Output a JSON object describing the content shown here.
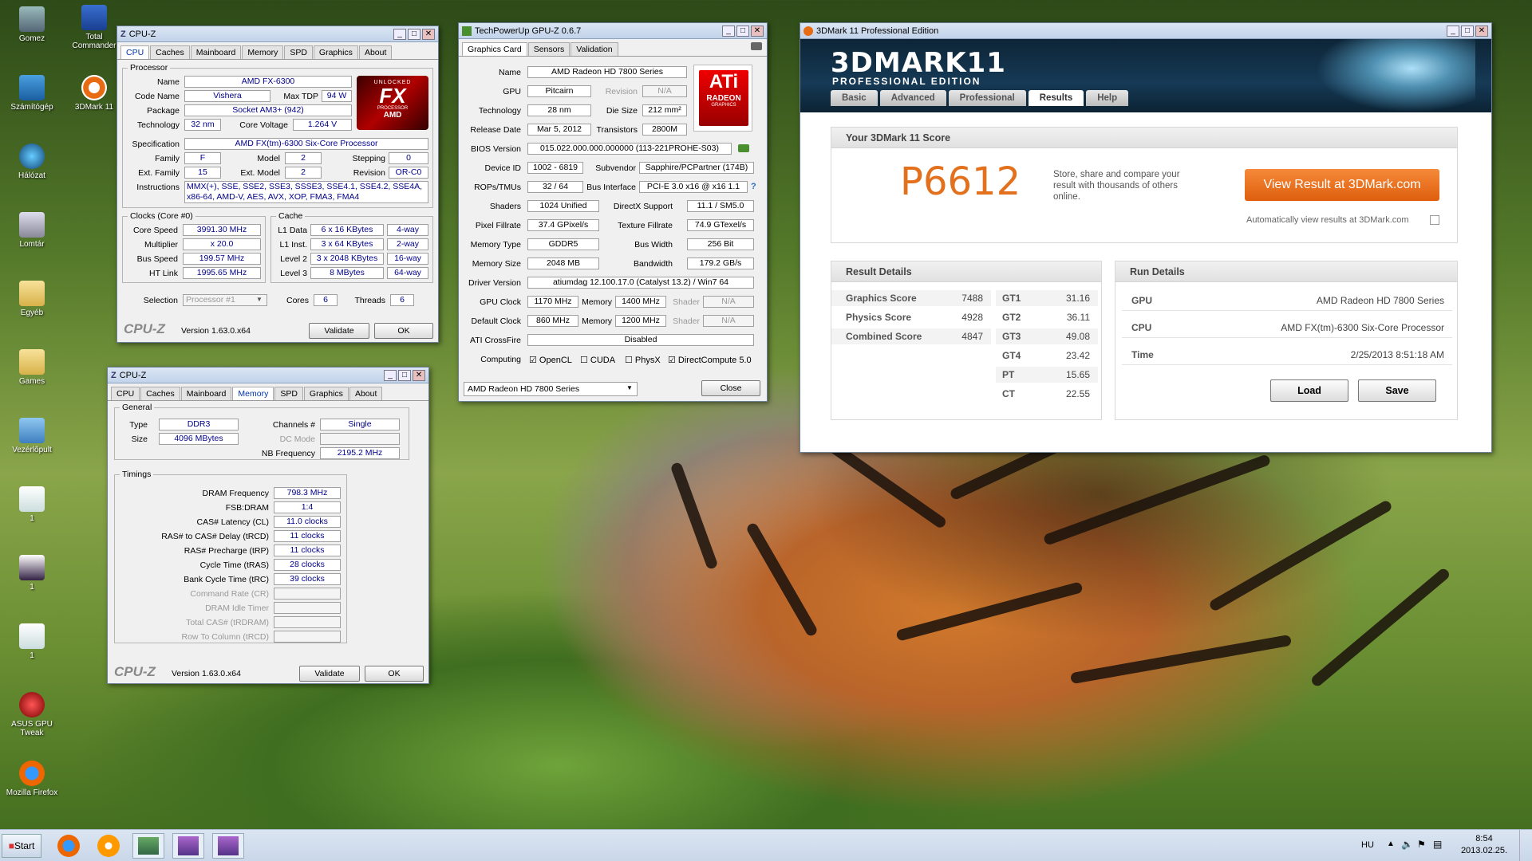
{
  "desktop": {
    "icons": [
      {
        "label": "Gomez"
      },
      {
        "label": "Total Commander"
      },
      {
        "label": "Számítógép"
      },
      {
        "label": "3DMark 11"
      },
      {
        "label": "Hálózat"
      },
      {
        "label": "Lomtár"
      },
      {
        "label": "Egyéb"
      },
      {
        "label": "Games"
      },
      {
        "label": "Vezérlőpult"
      },
      {
        "label": "1"
      },
      {
        "label": "1"
      },
      {
        "label": "1"
      },
      {
        "label": "ASUS GPU Tweak"
      },
      {
        "label": "Mozilla Firefox"
      }
    ]
  },
  "cpuz1": {
    "title": "CPU-Z",
    "tabs": [
      "CPU",
      "Caches",
      "Mainboard",
      "Memory",
      "SPD",
      "Graphics",
      "About"
    ],
    "active_tab": "CPU",
    "processor_group": "Processor",
    "name_lbl": "Name",
    "name": "AMD FX-6300",
    "codename_lbl": "Code Name",
    "codename": "Vishera",
    "maxtdp_lbl": "Max TDP",
    "maxtdp": "94 W",
    "package_lbl": "Package",
    "package": "Socket AM3+ (942)",
    "tech_lbl": "Technology",
    "tech": "32 nm",
    "corev_lbl": "Core Voltage",
    "corev": "1.264 V",
    "spec_lbl": "Specification",
    "spec": "AMD FX(tm)-6300 Six-Core Processor",
    "family_lbl": "Family",
    "family": "F",
    "model_lbl": "Model",
    "model": "2",
    "stepping_lbl": "Stepping",
    "stepping": "0",
    "extfam_lbl": "Ext. Family",
    "extfam": "15",
    "extmod_lbl": "Ext. Model",
    "extmod": "2",
    "revision_lbl": "Revision",
    "revision": "OR-C0",
    "instr_lbl": "Instructions",
    "instr": "MMX(+), SSE, SSE2, SSE3, SSSE3, SSE4.1, SSE4.2, SSE4A, x86-64, AMD-V, AES, AVX, XOP, FMA3, FMA4",
    "logo_top": "UNLOCKED",
    "logo_fx": "FX",
    "logo_sub": "PROCESSOR",
    "logo_amd": "AMD",
    "clocks_group": "Clocks (Core #0)",
    "corespeed_lbl": "Core Speed",
    "corespeed": "3991.30 MHz",
    "mult_lbl": "Multiplier",
    "mult": "x 20.0",
    "bus_lbl": "Bus Speed",
    "bus": "199.57 MHz",
    "ht_lbl": "HT Link",
    "ht": "1995.65 MHz",
    "cache_group": "Cache",
    "l1d_lbl": "L1 Data",
    "l1d": "6 x 16 KBytes",
    "l1d_way": "4-way",
    "l1i_lbl": "L1 Inst.",
    "l1i": "3 x 64 KBytes",
    "l1i_way": "2-way",
    "l2_lbl": "Level 2",
    "l2": "3 x 2048 KBytes",
    "l2_way": "16-way",
    "l3_lbl": "Level 3",
    "l3": "8 MBytes",
    "l3_way": "64-way",
    "selection_lbl": "Selection",
    "selection": "Processor #1",
    "cores_lbl": "Cores",
    "cores": "6",
    "threads_lbl": "Threads",
    "threads": "6",
    "logo": "CPU-Z",
    "version": "Version 1.63.0.x64",
    "validate": "Validate",
    "ok": "OK"
  },
  "cpuz2": {
    "title": "CPU-Z",
    "tabs": [
      "CPU",
      "Caches",
      "Mainboard",
      "Memory",
      "SPD",
      "Graphics",
      "About"
    ],
    "active_tab": "Memory",
    "general_group": "General",
    "type_lbl": "Type",
    "type": "DDR3",
    "channels_lbl": "Channels #",
    "channels": "Single",
    "size_lbl": "Size",
    "size": "4096 MBytes",
    "dcmode_lbl": "DC Mode",
    "nbfreq_lbl": "NB Frequency",
    "nbfreq": "2195.2 MHz",
    "timings_group": "Timings",
    "timings": [
      {
        "label": "DRAM Frequency",
        "value": "798.3 MHz",
        "enabled": true
      },
      {
        "label": "FSB:DRAM",
        "value": "1:4",
        "enabled": true
      },
      {
        "label": "CAS# Latency (CL)",
        "value": "11.0 clocks",
        "enabled": true
      },
      {
        "label": "RAS# to CAS# Delay (tRCD)",
        "value": "11 clocks",
        "enabled": true
      },
      {
        "label": "RAS# Precharge (tRP)",
        "value": "11 clocks",
        "enabled": true
      },
      {
        "label": "Cycle Time (tRAS)",
        "value": "28 clocks",
        "enabled": true
      },
      {
        "label": "Bank Cycle Time (tRC)",
        "value": "39 clocks",
        "enabled": true
      },
      {
        "label": "Command Rate (CR)",
        "value": "",
        "enabled": false
      },
      {
        "label": "DRAM Idle Timer",
        "value": "",
        "enabled": false
      },
      {
        "label": "Total CAS# (tRDRAM)",
        "value": "",
        "enabled": false
      },
      {
        "label": "Row To Column (tRCD)",
        "value": "",
        "enabled": false
      }
    ],
    "logo": "CPU-Z",
    "version": "Version 1.63.0.x64",
    "validate": "Validate",
    "ok": "OK"
  },
  "gpuz": {
    "title": "TechPowerUp GPU-Z 0.6.7",
    "tabs": [
      "Graphics Card",
      "Sensors",
      "Validation"
    ],
    "active_tab": "Graphics Card",
    "name_lbl": "Name",
    "name": "AMD Radeon HD 7800 Series",
    "gpu_lbl": "GPU",
    "gpu": "Pitcairn",
    "revision_lbl": "Revision",
    "revision": "N/A",
    "tech_lbl": "Technology",
    "tech": "28 nm",
    "diesize_lbl": "Die Size",
    "diesize": "212 mm²",
    "release_lbl": "Release Date",
    "release": "Mar 5, 2012",
    "transistors_lbl": "Transistors",
    "transistors": "2800M",
    "bios_lbl": "BIOS Version",
    "bios": "015.022.000.000.000000 (113-221PROHE-S03)",
    "devid_lbl": "Device ID",
    "devid": "1002 - 6819",
    "subvendor_lbl": "Subvendor",
    "subvendor": "Sapphire/PCPartner (174B)",
    "rops_lbl": "ROPs/TMUs",
    "rops": "32 / 64",
    "busif_lbl": "Bus Interface",
    "busif": "PCI-E 3.0 x16 @ x16 1.1",
    "help": "?",
    "shaders_lbl": "Shaders",
    "shaders": "1024 Unified",
    "dx_lbl": "DirectX Support",
    "dx": "11.1 / SM5.0",
    "pixel_lbl": "Pixel Fillrate",
    "pixel": "37.4 GPixel/s",
    "texture_lbl": "Texture Fillrate",
    "texture": "74.9 GTexel/s",
    "memtype_lbl": "Memory Type",
    "memtype": "GDDR5",
    "buswidth_lbl": "Bus Width",
    "buswidth": "256 Bit",
    "memsize_lbl": "Memory Size",
    "memsize": "2048 MB",
    "bandwidth_lbl": "Bandwidth",
    "bandwidth": "179.2 GB/s",
    "driver_lbl": "Driver Version",
    "driver": "atiumdag 12.100.17.0 (Catalyst 13.2) / Win7 64",
    "gpuclock_lbl": "GPU Clock",
    "gpuclock": "1170 MHz",
    "memory_lbl": "Memory",
    "memclock": "1400 MHz",
    "shader_lbl": "Shader",
    "shader": "N/A",
    "defclock_lbl": "Default Clock",
    "defclock": "860 MHz",
    "defmem": "1200 MHz",
    "defshader": "N/A",
    "crossfire_lbl": "ATI CrossFire",
    "crossfire": "Disabled",
    "computing_lbl": "Computing",
    "opencl": "OpenCL",
    "cuda": "CUDA",
    "physx": "PhysX",
    "dcompute": "DirectCompute 5.0",
    "card_select": "AMD Radeon HD 7800 Series",
    "close": "Close",
    "logo_ati": "ATi",
    "logo_radeon": "RADEON",
    "logo_graphics": "GRAPHICS"
  },
  "tdmark": {
    "title": "3DMark 11 Professional Edition",
    "brand": "3DMARK11",
    "edition": "PROFESSIONAL EDITION",
    "tabs": [
      "Basic",
      "Advanced",
      "Professional",
      "Results",
      "Help"
    ],
    "active_tab": "Results",
    "score_header": "Your 3DMark 11 Score",
    "score": "P6612",
    "score_desc": "Store, share and compare your result with thousands of others online.",
    "view_button": "View Result at 3DMark.com",
    "auto_view": "Automatically view results at 3DMark.com",
    "result_header": "Result Details",
    "results": [
      {
        "label": "Graphics Score",
        "value": "7488"
      },
      {
        "label": "Physics Score",
        "value": "4928"
      },
      {
        "label": "Combined Score",
        "value": "4847"
      }
    ],
    "gt": [
      {
        "label": "GT1",
        "value": "31.16"
      },
      {
        "label": "GT2",
        "value": "36.11"
      },
      {
        "label": "GT3",
        "value": "49.08"
      },
      {
        "label": "GT4",
        "value": "23.42"
      },
      {
        "label": "PT",
        "value": "15.65"
      },
      {
        "label": "CT",
        "value": "22.55"
      }
    ],
    "run_header": "Run Details",
    "run": [
      {
        "label": "GPU",
        "value": "AMD Radeon HD 7800 Series"
      },
      {
        "label": "CPU",
        "value": "AMD FX(tm)-6300 Six-Core Processor"
      },
      {
        "label": "Time",
        "value": "2/25/2013 8:51:18 AM"
      }
    ],
    "load": "Load",
    "save": "Save"
  },
  "taskbar": {
    "start": "Start",
    "lang": "HU",
    "time": "8:54",
    "date": "2013.02.25."
  },
  "colors": {
    "score_orange": "#e3701c",
    "view_button": "#e86a12",
    "value_blue": "#00008b"
  }
}
